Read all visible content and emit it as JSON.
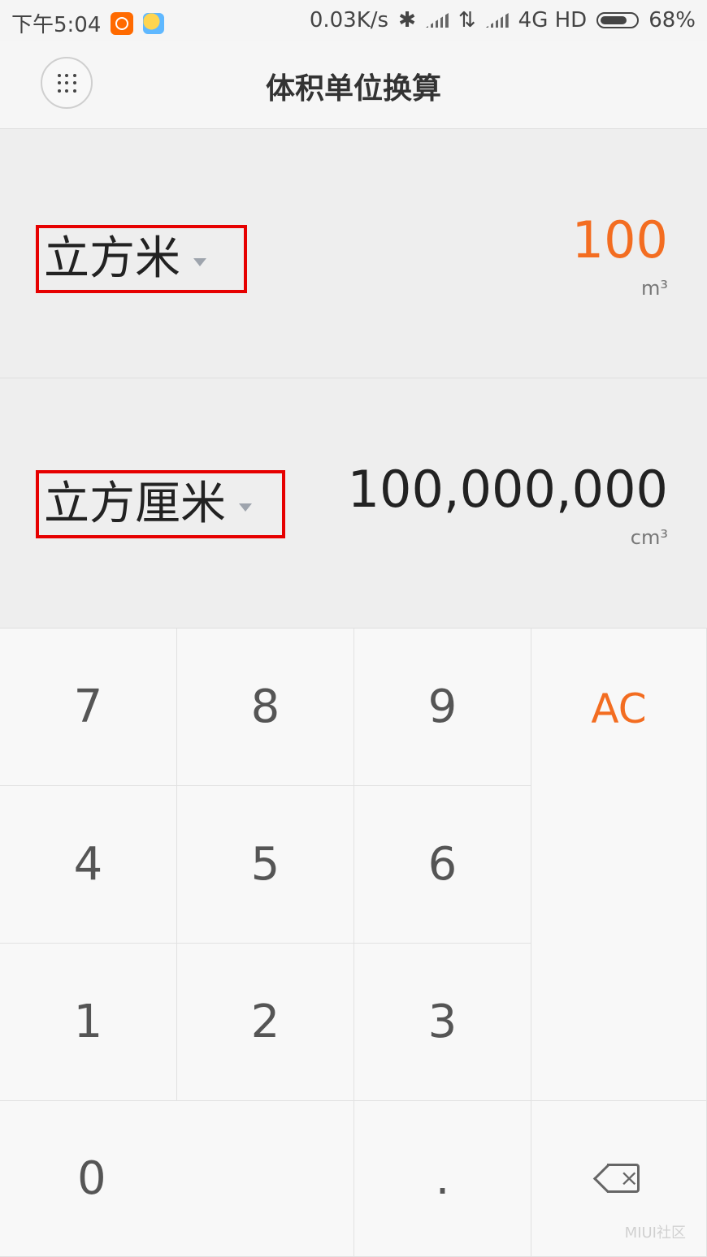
{
  "status_bar": {
    "time": "下午5:04",
    "network_speed": "0.03K/s",
    "network_type": "4G HD",
    "battery": "68%"
  },
  "header": {
    "title": "体积单位换算"
  },
  "converter": {
    "from": {
      "unit_name": "立方米",
      "value": "100",
      "unit_symbol": "m³"
    },
    "to": {
      "unit_name": "立方厘米",
      "value": "100,000,000",
      "unit_symbol": "cm³"
    }
  },
  "keypad": {
    "keys": {
      "seven": "7",
      "eight": "8",
      "nine": "9",
      "ac": "AC",
      "four": "4",
      "five": "5",
      "six": "6",
      "one": "1",
      "two": "2",
      "three": "3",
      "zero": "0",
      "dot": "."
    }
  },
  "watermark": "MIUI社区",
  "colors": {
    "accent": "#f36d21",
    "selection_outline": "#e60000"
  }
}
